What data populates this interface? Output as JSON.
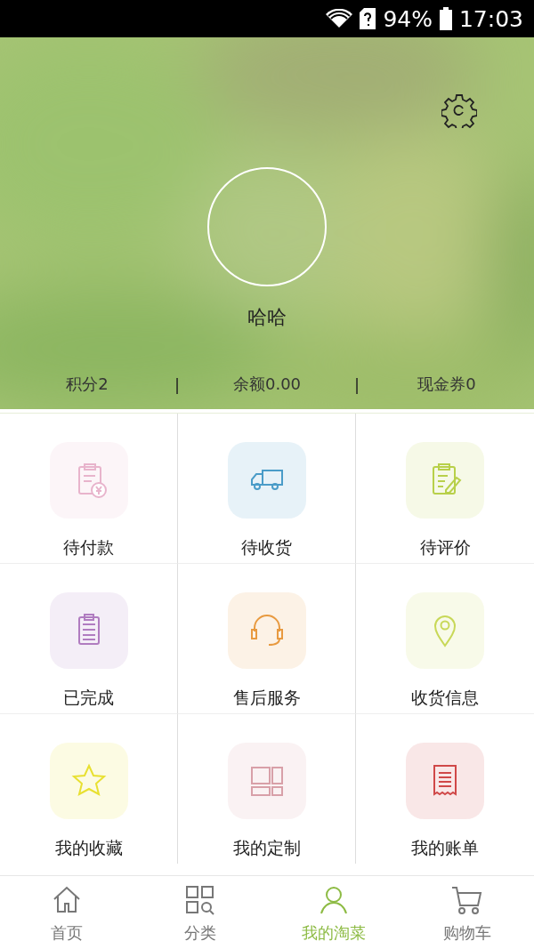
{
  "status_bar": {
    "battery": "94%",
    "time": "17:03"
  },
  "profile": {
    "name": "哈哈",
    "stats": [
      {
        "label": "积分2"
      },
      {
        "label": "余额0.00"
      },
      {
        "label": "现金券0"
      }
    ],
    "separator": "|"
  },
  "menu": [
    {
      "label": "待付款",
      "color": "#e8b4cc"
    },
    {
      "label": "待收货",
      "color": "#4a9cc8"
    },
    {
      "label": "待评价",
      "color": "#b8d04a"
    },
    {
      "label": "已完成",
      "color": "#b07cc0"
    },
    {
      "label": "售后服务",
      "color": "#e89a40"
    },
    {
      "label": "收货信息",
      "color": "#c8d858"
    },
    {
      "label": "我的收藏",
      "color": "#e8e030"
    },
    {
      "label": "我的定制",
      "color": "#d8a0a8"
    },
    {
      "label": "我的账单",
      "color": "#d04848"
    }
  ],
  "tabs": [
    {
      "label": "首页",
      "selected": false
    },
    {
      "label": "分类",
      "selected": false
    },
    {
      "label": "我的淘菜",
      "selected": true
    },
    {
      "label": "购物车",
      "selected": false
    }
  ]
}
